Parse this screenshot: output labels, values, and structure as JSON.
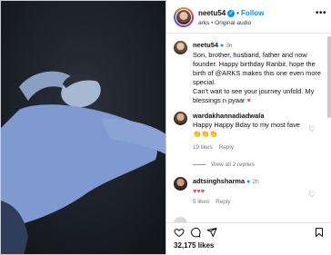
{
  "header": {
    "username": "neetu54",
    "verified_glyph": "✓",
    "separator": "•",
    "follow_label": "Follow",
    "subtitle": "arks • Original audio",
    "more_label": "•••"
  },
  "caption": {
    "username": "neetu54",
    "time": "3h",
    "text": "Son, brother, husband, father and now founder. Happy birthday Ranbir, hope the birth of @ARKS makes this one even more special.",
    "text2": "Can't wait to see your journey unfold. My blessings n pyaar",
    "heart": "♥"
  },
  "comments": [
    {
      "username": "wardakhannadiadwala",
      "time": "2h",
      "text": "Happy Happy Bday to my most fave",
      "emoji": "👏👏👏",
      "likes": "19 likes",
      "reply_label": "Reply",
      "view_replies": "View all 2 replies"
    },
    {
      "username": "adtsinghsharma",
      "time": "2h",
      "text": "♥♥♥",
      "likes": "5 likes",
      "reply_label": "Reply"
    }
  ],
  "footer": {
    "likes_count": "32,175 likes"
  },
  "colors": {
    "accent": "#0095f6",
    "heart": "#ed4956"
  },
  "icons": [
    "heart-icon",
    "comment-icon",
    "share-icon",
    "bookmark-icon",
    "more-icon",
    "verified-icon"
  ]
}
